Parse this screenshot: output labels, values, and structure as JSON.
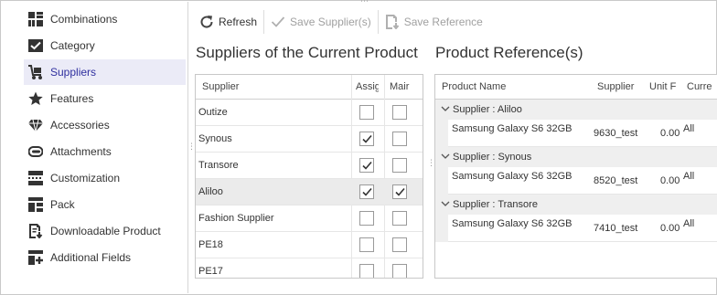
{
  "sidebar": {
    "items": [
      {
        "label": "Combinations",
        "icon": "combinations-icon"
      },
      {
        "label": "Category",
        "icon": "category-check-icon"
      },
      {
        "label": "Suppliers",
        "icon": "suppliers-cart-icon",
        "active": true
      },
      {
        "label": "Features",
        "icon": "star-icon"
      },
      {
        "label": "Accessories",
        "icon": "diamond-icon"
      },
      {
        "label": "Attachments",
        "icon": "attachment-icon"
      },
      {
        "label": "Customization",
        "icon": "customization-icon"
      },
      {
        "label": "Pack",
        "icon": "pack-icon"
      },
      {
        "label": "Downloadable Product",
        "icon": "download-file-icon"
      },
      {
        "label": "Additional Fields",
        "icon": "additional-fields-icon"
      }
    ]
  },
  "toolbar": {
    "refresh_label": "Refresh",
    "save_suppliers_label": "Save Supplier(s)",
    "save_reference_label": "Save Reference"
  },
  "suppliers_panel": {
    "title": "Suppliers of the Current Product",
    "columns": [
      "Supplier",
      "Assig",
      "Mair"
    ],
    "rows": [
      {
        "name": "Outize",
        "assigned": false,
        "main": false
      },
      {
        "name": "Synous",
        "assigned": true,
        "main": false
      },
      {
        "name": "Transore",
        "assigned": true,
        "main": false
      },
      {
        "name": "Aliloo",
        "assigned": true,
        "main": true,
        "selected": true
      },
      {
        "name": "Fashion Supplier",
        "assigned": false,
        "main": false
      },
      {
        "name": "PE18",
        "assigned": false,
        "main": false
      },
      {
        "name": "PE17",
        "assigned": false,
        "main": false
      }
    ]
  },
  "reference_panel": {
    "title": "Product Reference(s)",
    "columns": [
      "Product Name",
      "Supplier",
      "Unit F",
      "Curre"
    ],
    "groups": [
      {
        "label": "Supplier : Aliloo",
        "row": {
          "product": "Samsung Galaxy S6 32GB",
          "reference": "9630_test",
          "price": "0.00",
          "currency": "All"
        }
      },
      {
        "label": "Supplier : Synous",
        "row": {
          "product": "Samsung Galaxy S6 32GB",
          "reference": "8520_test",
          "price": "0.00",
          "currency": "All"
        }
      },
      {
        "label": "Supplier : Transore",
        "row": {
          "product": "Samsung Galaxy S6 32GB",
          "reference": "7410_test",
          "price": "0.00",
          "currency": "All"
        }
      }
    ]
  },
  "colors": {
    "active_bg": "#ebebf7",
    "active_text": "#2f2f9f",
    "icon_dark": "#333333"
  }
}
